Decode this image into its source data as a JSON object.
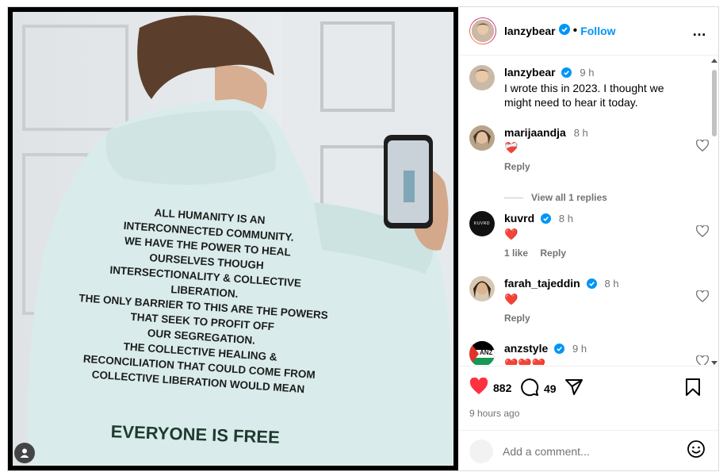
{
  "post": {
    "hoodie_text_lines": [
      "ALL HUMANITY IS AN",
      "INTERCONNECTED COMMUNITY.",
      "WE HAVE THE POWER TO HEAL",
      "OURSELVES THOUGH",
      "INTERSECTIONALITY & COLLECTIVE",
      "LIBERATION.",
      "THE ONLY BARRIER TO THIS ARE THE POWERS",
      "THAT SEEK TO PROFIT OFF",
      "OUR SEGREGATION.",
      "THE COLLECTIVE HEALING &",
      "RECONCILIATION THAT COULD COME FROM",
      "COLLECTIVE LIBERATION WOULD MEAN"
    ],
    "hoodie_big_line": "EVERYONE IS FREE"
  },
  "header": {
    "username": "lanzybear",
    "dot": "•",
    "follow_label": "Follow",
    "more_icon": "…"
  },
  "caption": {
    "username": "lanzybear",
    "time": "9 h",
    "text": "I wrote this in 2023. I thought we might need to hear it today."
  },
  "comments": [
    {
      "username": "marijaandja",
      "time": "8 h",
      "text": "❤️‍🩹",
      "reply_label": "Reply"
    },
    {
      "username": "kuvrd",
      "time": "8 h",
      "text": "❤️",
      "likes": "1 like",
      "reply_label": "Reply",
      "avatar_text": "KUVRD"
    },
    {
      "username": "farah_tajeddin",
      "time": "8 h",
      "text": "❤️",
      "reply_label": "Reply"
    },
    {
      "username": "anzstyle",
      "time": "9 h",
      "text": "❤️❤️❤️",
      "avatar_text": "ANZ"
    }
  ],
  "view_replies": "View all 1 replies",
  "stats": {
    "likes": "882",
    "comments": "49",
    "posted": "9 hours ago"
  },
  "add_comment": {
    "placeholder": "Add a comment..."
  },
  "colors": {
    "accent": "#0095f6",
    "verified": "#0095f6",
    "heart": "#ff3040",
    "muted": "#737373"
  }
}
